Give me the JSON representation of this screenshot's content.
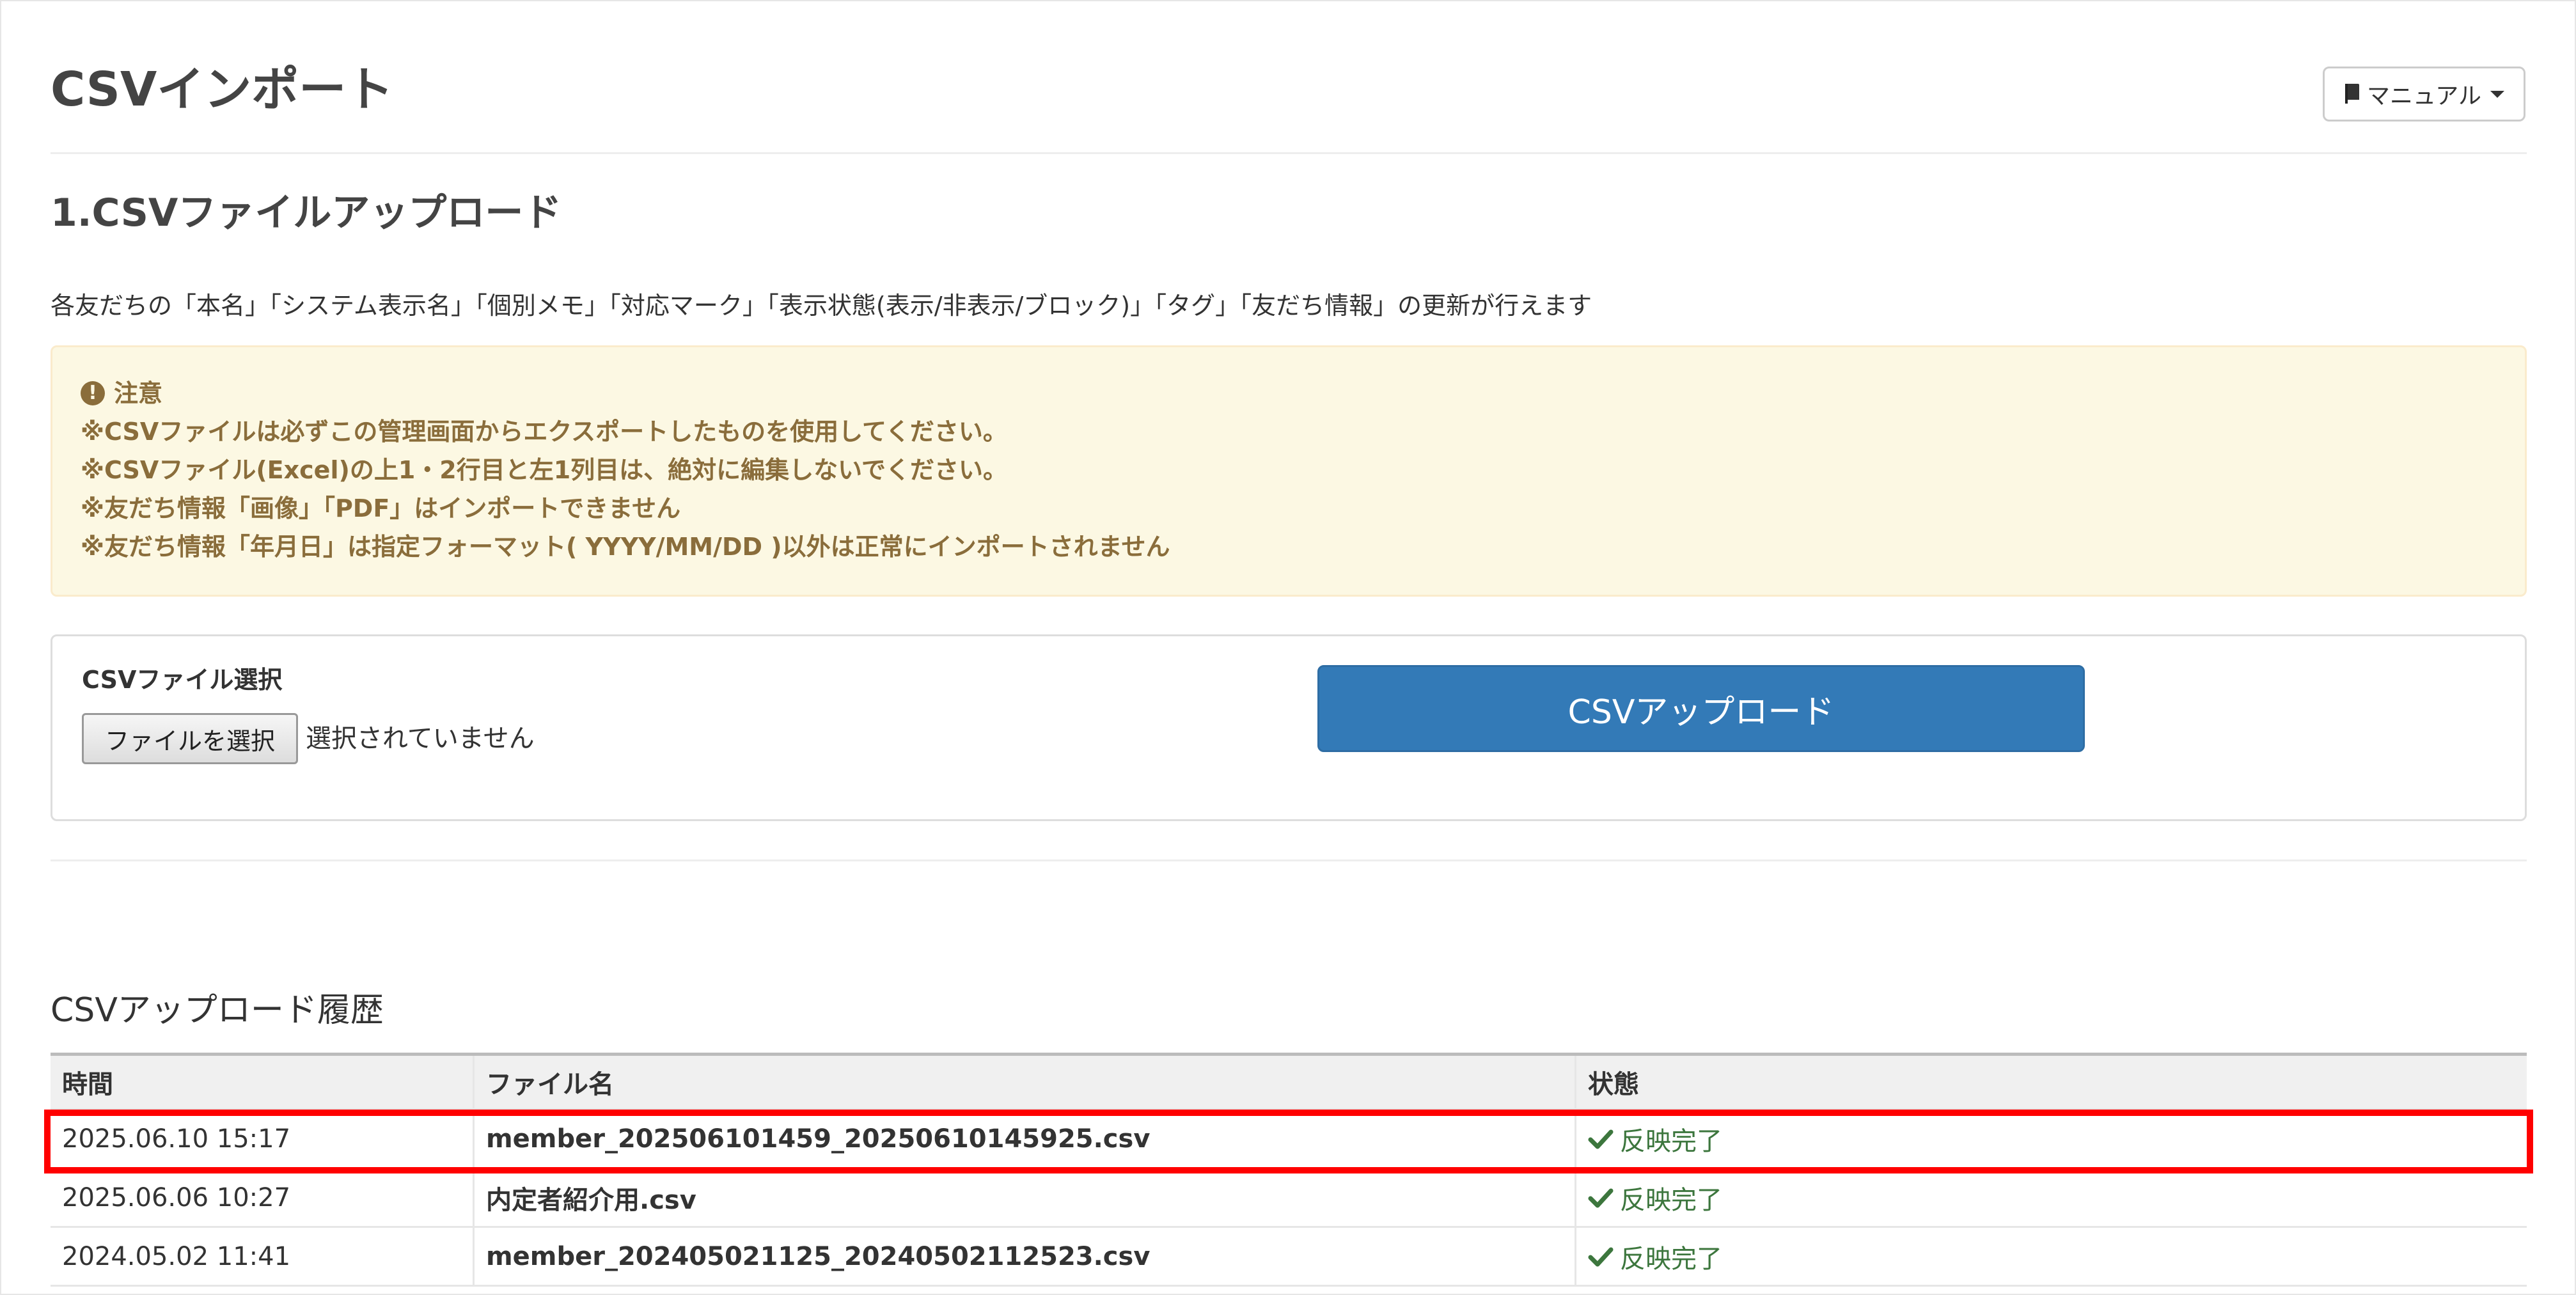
{
  "header": {
    "title": "CSVインポート",
    "manual_label": "マニュアル"
  },
  "upload_section": {
    "title": "1.CSVファイルアップロード",
    "description": "各友だちの「本名」「システム表示名」「個別メモ」「対応マーク」「表示状態(表示/非表示/ブロック)」「タグ」「友だち情報」の更新が行えます",
    "notice": {
      "heading": "注意",
      "lines": [
        "※CSVファイルは必ずこの管理画面からエクスポートしたものを使用してください。",
        "※CSVファイル(Excel)の上1・2行目と左1列目は、絶対に編集しないでください。",
        "※友だち情報「画像」「PDF」はインポートできません",
        "※友だち情報「年月日」は指定フォーマット( YYYY/MM/DD )以外は正常にインポートされません"
      ]
    },
    "file_select_label": "CSVファイル選択",
    "file_button_label": "ファイルを選択",
    "file_status": "選択されていません",
    "upload_button_label": "CSVアップロード"
  },
  "history": {
    "title": "CSVアップロード履歴",
    "columns": [
      "時間",
      "ファイル名",
      "状態"
    ],
    "rows": [
      {
        "time": "2025.06.10 15:17",
        "filename": "member_202506101459_20250610145925.csv",
        "status": "反映完了"
      },
      {
        "time": "2025.06.06 10:27",
        "filename": "内定者紹介用.csv",
        "status": "反映完了"
      },
      {
        "time": "2024.05.02 11:41",
        "filename": "member_202405021125_20240502112523.csv",
        "status": "反映完了"
      }
    ]
  },
  "colors": {
    "primary": "#337ab7",
    "warning_bg": "#fcf8e3",
    "warning_text": "#8a6d3b",
    "success_text": "#3c763d",
    "highlight": "#ff0000"
  }
}
